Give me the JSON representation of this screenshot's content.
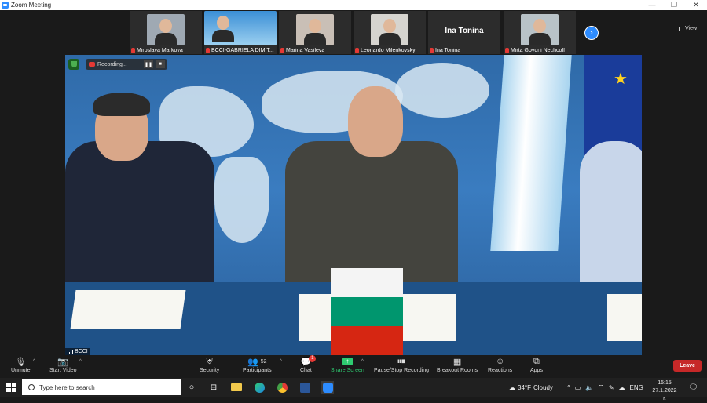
{
  "window": {
    "title": "Zoom Meeting",
    "minimize": "—",
    "restore": "❐",
    "close": "✕"
  },
  "gallery": {
    "participants": [
      {
        "name": "Miroslava Markova"
      },
      {
        "name": "BCCI-GABRIELA DIMIT..."
      },
      {
        "name": "Marina Vasileva"
      },
      {
        "name": "Leonardo Milenkovsky"
      },
      {
        "name": "Ina Tonina",
        "display_name": "Ina Tonina"
      },
      {
        "name": "Mirta Govoni Nechcoff"
      }
    ],
    "next_label": "›",
    "view_label": "View"
  },
  "main_video": {
    "recording_label": "Recording...",
    "pause_glyph": "❚❚",
    "stop_glyph": "■",
    "speaker_name": "BCCI"
  },
  "toolbar": {
    "unmute": "Unmute",
    "start_video": "Start Video",
    "security": "Security",
    "participants": "Participants",
    "participants_count": "52",
    "chat": "Chat",
    "chat_badge": "1",
    "share_screen": "Share Screen",
    "pause_stop_recording": "Pause/Stop Recording",
    "breakout_rooms": "Breakout Rooms",
    "reactions": "Reactions",
    "apps": "Apps",
    "leave": "Leave",
    "caret": "^"
  },
  "taskbar": {
    "search_placeholder": "Type here to search",
    "weather_temp": "34°F",
    "weather_text": "Cloudy",
    "language": "ENG",
    "time": "15:15",
    "date": "27.1.2022 г."
  },
  "colors": {
    "accent": "#2d8cff",
    "leave": "#c62828",
    "share_green": "#2ecc71",
    "mute_red": "#e53935"
  }
}
